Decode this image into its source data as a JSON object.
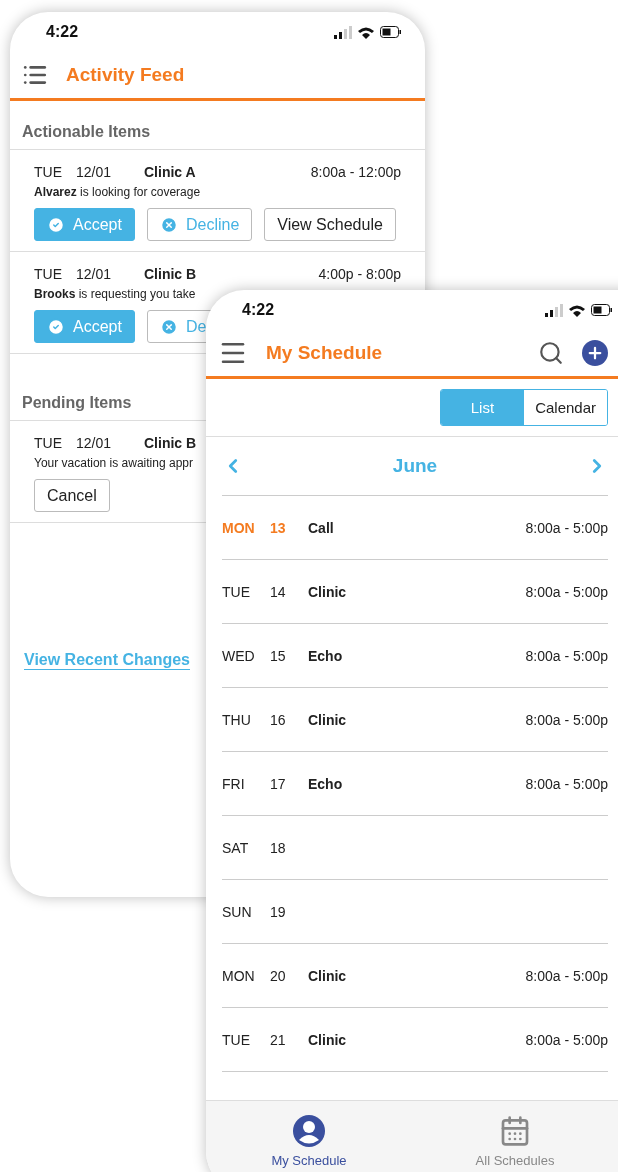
{
  "activity_phone": {
    "status_time": "4:22",
    "title": "Activity Feed",
    "actionable": {
      "heading": "Actionable Items",
      "items": [
        {
          "day": "TUE",
          "date": "12/01",
          "place": "Clinic A",
          "time": "8:00a - 12:00p",
          "message": "**Alvarez** is looking for coverage",
          "buttons": [
            {
              "kind": "accept",
              "label": "Accept"
            },
            {
              "kind": "decline",
              "label": "Decline"
            },
            {
              "kind": "plain",
              "label": "View Schedule"
            }
          ]
        },
        {
          "day": "TUE",
          "date": "12/01",
          "place": "Clinic B",
          "time": "4:00p - 8:00p",
          "message": "**Brooks** is requesting you take",
          "buttons": [
            {
              "kind": "accept",
              "label": "Accept"
            },
            {
              "kind": "decline",
              "label": "De"
            }
          ]
        }
      ]
    },
    "pending": {
      "heading": "Pending Items",
      "items": [
        {
          "day": "TUE",
          "date": "12/01",
          "place": "Clinic B",
          "message": "Your vacation is awaiting appr",
          "buttons": [
            {
              "kind": "plain",
              "label": "Cancel"
            }
          ]
        }
      ]
    },
    "link": "View Recent Changes"
  },
  "schedule_phone": {
    "status_time": "4:22",
    "title": "My Schedule",
    "view_toggle": [
      {
        "label": "List",
        "selected": true
      },
      {
        "label": "Calendar",
        "selected": false
      }
    ],
    "month": "June",
    "days": [
      {
        "day": "MON",
        "date": "13",
        "shift": "Call",
        "time": "8:00a - 5:00p",
        "today": true
      },
      {
        "day": "TUE",
        "date": "14",
        "shift": "Clinic",
        "time": "8:00a - 5:00p",
        "today": false
      },
      {
        "day": "WED",
        "date": "15",
        "shift": "Echo",
        "time": "8:00a - 5:00p",
        "today": false
      },
      {
        "day": "THU",
        "date": "16",
        "shift": "Clinic",
        "time": "8:00a - 5:00p",
        "today": false
      },
      {
        "day": "FRI",
        "date": "17",
        "shift": "Echo",
        "time": "8:00a - 5:00p",
        "today": false
      },
      {
        "day": "SAT",
        "date": "18",
        "today": false
      },
      {
        "day": "SUN",
        "date": "19",
        "today": false
      },
      {
        "day": "MON",
        "date": "20",
        "shift": "Clinic",
        "time": "8:00a - 5:00p",
        "today": false
      },
      {
        "day": "TUE",
        "date": "21",
        "shift": "Clinic",
        "time": "8:00a - 5:00p",
        "today": false
      }
    ],
    "tab_bar": [
      {
        "kind": "person",
        "label": "My Schedule",
        "selected": true
      },
      {
        "kind": "calendar",
        "label": "All Schedules",
        "selected": false
      }
    ]
  }
}
